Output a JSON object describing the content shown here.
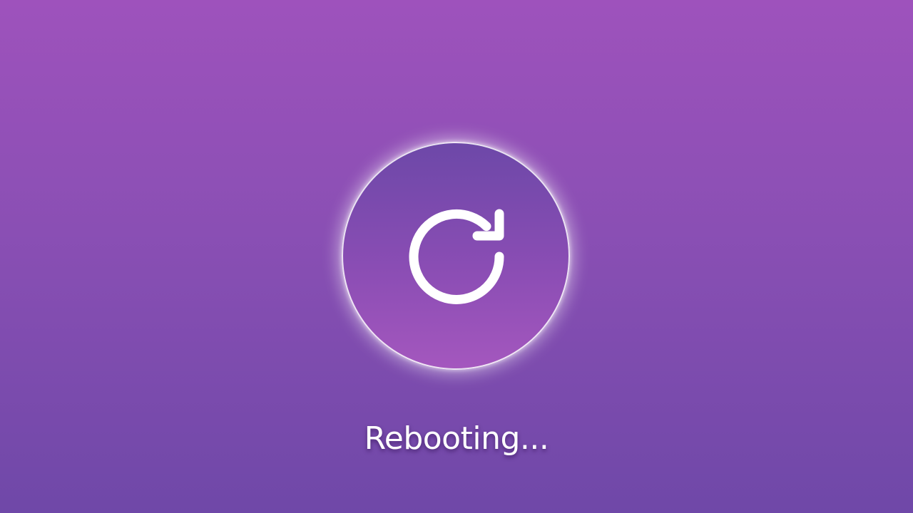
{
  "status": {
    "text": "Rebooting..."
  },
  "icon": {
    "name": "reboot-icon"
  },
  "colors": {
    "background_top": "#9e52bc",
    "background_bottom": "#6f48a8",
    "circle_top": "#6d48a8",
    "circle_bottom": "#a457be",
    "foreground": "#ffffff"
  }
}
